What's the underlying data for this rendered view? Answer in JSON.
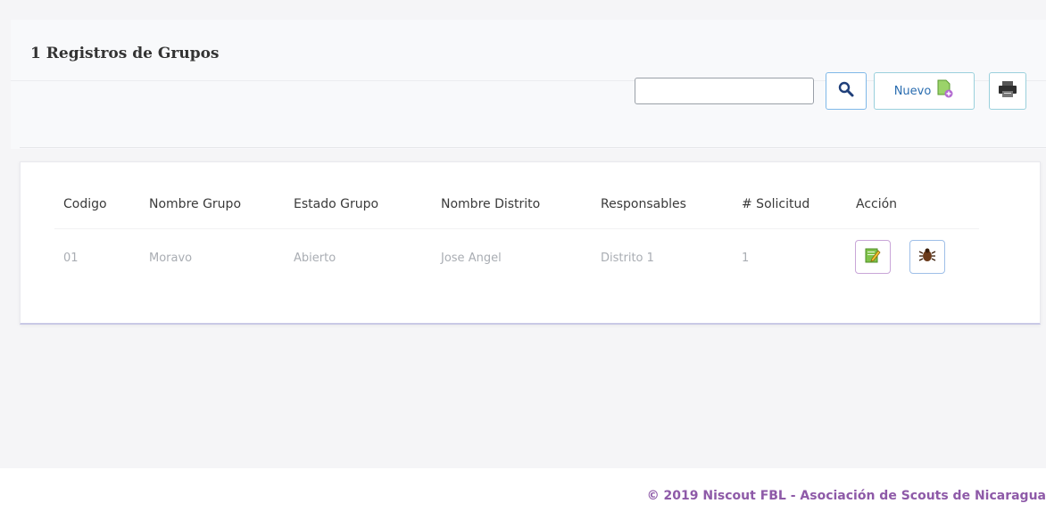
{
  "panel": {
    "title": "1 Registros de Grupos",
    "search_value": "",
    "nuevo_label": "Nuevo"
  },
  "table": {
    "headers": [
      "Codigo",
      "Nombre Grupo",
      "Estado Grupo",
      "Nombre Distrito",
      "Responsables",
      "# Solicitud",
      "Acción"
    ],
    "rows": [
      [
        "01",
        "Moravo",
        "Abierto",
        "Jose Angel",
        "Distrito 1",
        "1"
      ]
    ]
  },
  "footer": {
    "text": "© 2019 Niscout FBL - Asociación de Scouts de Nicaragua"
  },
  "icons": {
    "search": "magnifier-icon",
    "nuevo": "new-document-icon",
    "print": "printer-icon",
    "edit": "edit-icon",
    "delete": "bug-icon"
  },
  "colors": {
    "footer_text": "#8e5aa8",
    "nuevo_text": "#2a6db0"
  }
}
